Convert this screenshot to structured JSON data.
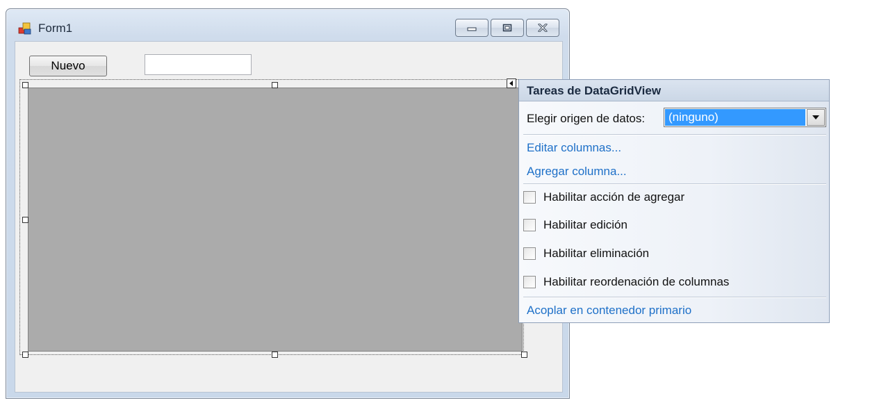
{
  "window": {
    "title": "Form1",
    "icon": "winforms-app-icon"
  },
  "form": {
    "nuevo_label": "Nuevo",
    "textbox_value": ""
  },
  "smart_tag": {
    "title": "Tareas de DataGridView",
    "datasource_label": "Elegir origen de datos:",
    "datasource_value": "(ninguno)",
    "links": [
      "Editar columnas...",
      "Agregar columna..."
    ],
    "checkboxes": [
      {
        "label": "Habilitar acción de agregar",
        "checked": false
      },
      {
        "label": "Habilitar edición",
        "checked": false
      },
      {
        "label": "Habilitar eliminación",
        "checked": false
      },
      {
        "label": "Habilitar reordenación de columnas",
        "checked": false
      }
    ],
    "dock_link": "Acoplar en contenedor primario"
  },
  "colors": {
    "grid_background": "#ababab",
    "selection": "#3399ff",
    "link": "#1e70c8"
  }
}
